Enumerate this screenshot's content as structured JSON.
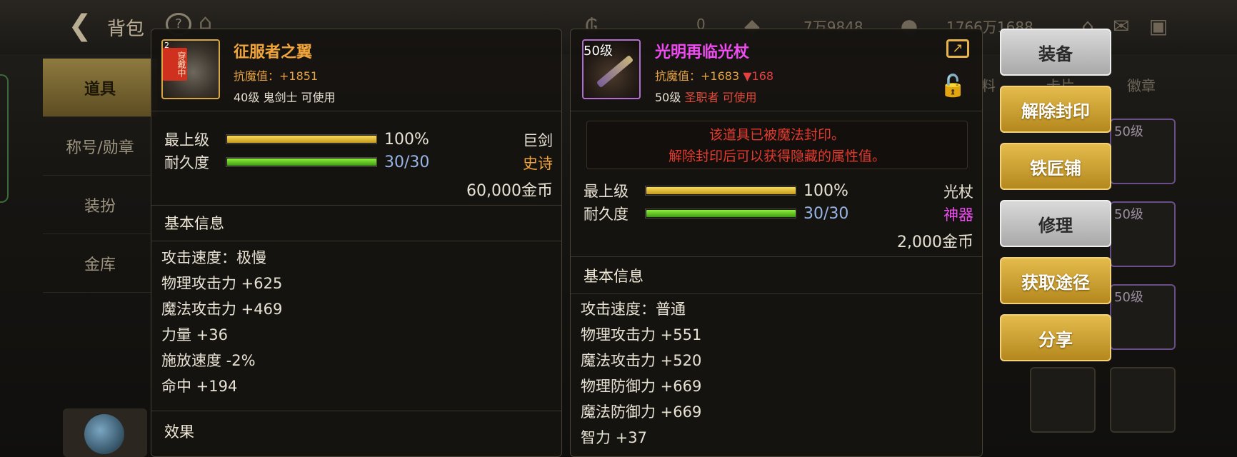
{
  "header": {
    "title": "背包",
    "currency1": "0",
    "currency2": "7万9848",
    "currency3": "1766万1688"
  },
  "left_nav": {
    "items": [
      {
        "label": "道具",
        "active": true
      },
      {
        "label": "称号/勋章",
        "active": false
      },
      {
        "label": "装扮",
        "active": false
      },
      {
        "label": "金库",
        "active": false
      }
    ]
  },
  "bag_tabs": {
    "tab_partial": "料",
    "tab_partial2": "卡片",
    "tab_badge": "徽章"
  },
  "grid_cells": [
    {
      "level": "50级"
    },
    {
      "level": "50级"
    },
    {
      "level": "50级"
    }
  ],
  "equipped_item": {
    "worn_tag": "穿戴中",
    "level_tag": "2",
    "name": "征服者之翼",
    "magic_resist": "抗魔值：+1851",
    "requirement": "40级 鬼剑士 可使用",
    "grade_label": "最上级",
    "grade_value": "100%",
    "grade_percent": 100,
    "durability_label": "耐久度",
    "durability_value": "30/30",
    "durability_percent": 100,
    "weapon_type": "巨剑",
    "rarity": "史诗",
    "price": "60,000金币",
    "basic_info_title": "基本信息",
    "attributes": [
      "攻击速度：极慢",
      "物理攻击力 +625",
      "魔法攻击力 +469",
      "力量 +36",
      "施放速度 -2%",
      "命中 +194"
    ],
    "effect_title": "效果"
  },
  "compare_item": {
    "level_tag": "50级",
    "name": "光明再临光杖",
    "magic_resist": "抗魔值：+1683",
    "magic_resist_diff": "▼168",
    "req_level": "50级",
    "req_class": "圣职者 可使用",
    "seal_line1": "该道具已被魔法封印。",
    "seal_line2": "解除封印后可以获得隐藏的属性值。",
    "grade_label": "最上级",
    "grade_value": "100%",
    "grade_percent": 100,
    "durability_label": "耐久度",
    "durability_value": "30/30",
    "durability_percent": 100,
    "weapon_type": "光杖",
    "rarity": "神器",
    "price": "2,000金币",
    "basic_info_title": "基本信息",
    "attributes": [
      "攻击速度：普通",
      "物理攻击力 +551",
      "魔法攻击力 +520",
      "物理防御力 +669",
      "魔法防御力 +669",
      "智力 +37"
    ]
  },
  "actions": {
    "equip": "装备",
    "unseal": "解除封印",
    "smith": "铁匠铺",
    "repair": "修理",
    "source": "获取途径",
    "share": "分享"
  },
  "colors": {
    "epic": "#f0a43a",
    "artifact": "#ee4cf0",
    "seal_text": "#e53a2e",
    "gold_button": "#d4a63a",
    "silver_button": "#c4c4c4"
  }
}
